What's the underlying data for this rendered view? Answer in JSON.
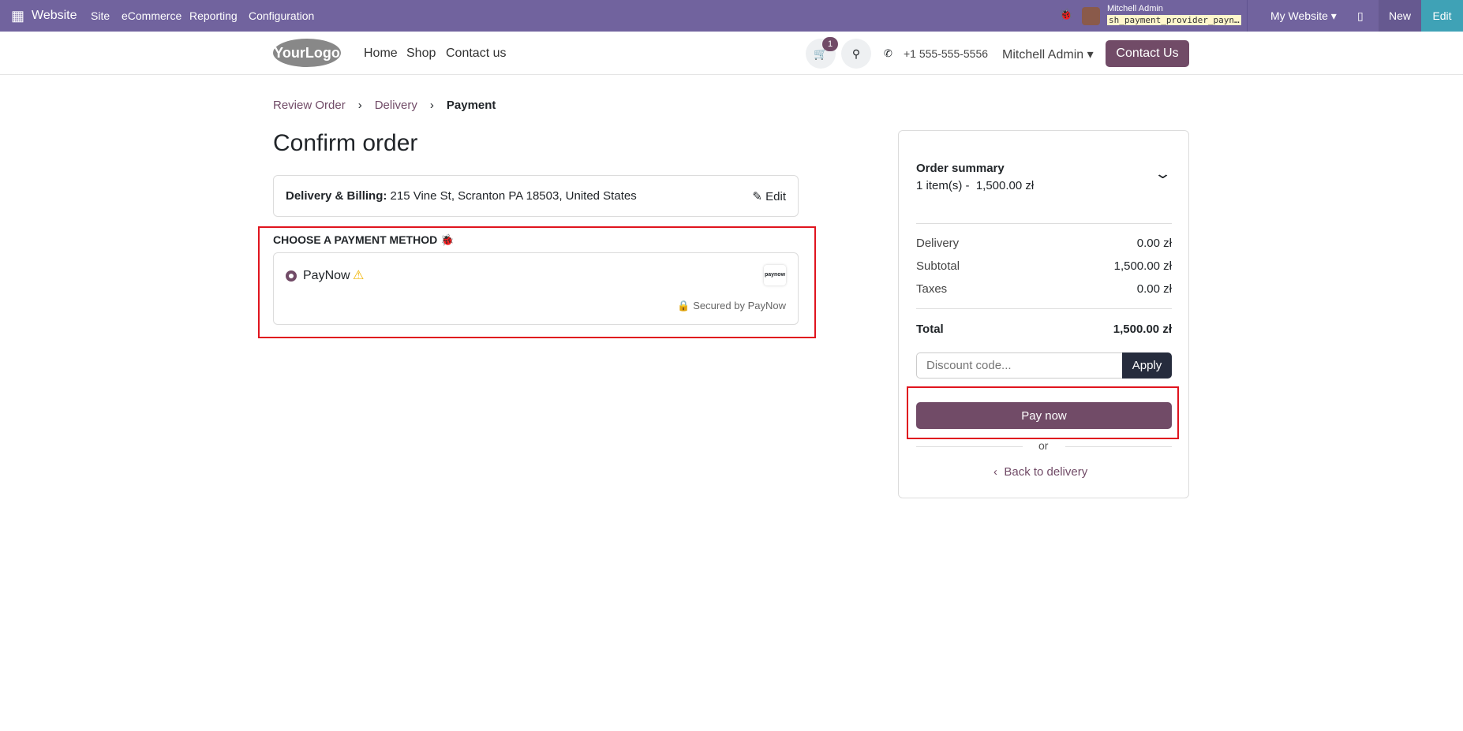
{
  "topbar": {
    "app": "Website",
    "menu": [
      "Site",
      "eCommerce",
      "Reporting",
      "Configuration"
    ],
    "user": "Mitchell Admin",
    "db": "sh_payment_provider_payn…",
    "website": "My Website",
    "new": "New",
    "edit": "Edit"
  },
  "header": {
    "logo": "YourLogo",
    "nav": [
      "Home",
      "Shop",
      "Contact us"
    ],
    "cart_count": "1",
    "phone": "+1 555-555-5556",
    "user": "Mitchell Admin",
    "contact": "Contact Us"
  },
  "breadcrumb": [
    "Review Order",
    "Delivery",
    "Payment"
  ],
  "title": "Confirm order",
  "address": {
    "label": "Delivery & Billing:",
    "value": "215 Vine St, Scranton PA 18503, United States",
    "edit": "Edit"
  },
  "payment": {
    "heading": "CHOOSE A PAYMENT METHOD",
    "method": "PayNow",
    "logo": "paynow",
    "secured": "Secured by PayNow"
  },
  "summary": {
    "title": "Order summary",
    "items": "1 item(s) -  1,500.00 zł",
    "rows": [
      {
        "label": "Delivery",
        "value": "0.00 zł"
      },
      {
        "label": "Subtotal",
        "value": "1,500.00 zł"
      },
      {
        "label": "Taxes",
        "value": "0.00 zł"
      }
    ],
    "total_label": "Total",
    "total": "1,500.00 zł",
    "discount_placeholder": "Discount code...",
    "apply": "Apply",
    "pay": "Pay now",
    "or": "or",
    "back": "Back to delivery"
  },
  "colors": {
    "brand": "#714b67",
    "topbar": "#71639e",
    "edit": "#3fa2b6"
  }
}
